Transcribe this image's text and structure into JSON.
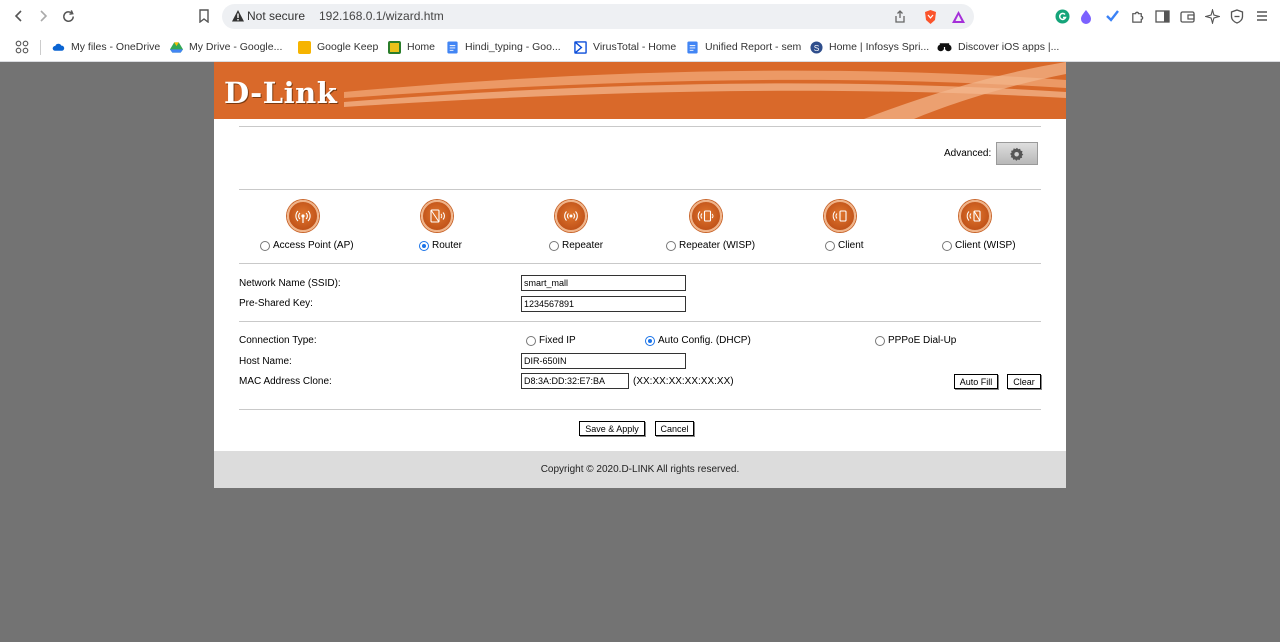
{
  "browser": {
    "security_label": "Not secure",
    "url": "192.168.0.1/wizard.htm",
    "bookmarks": [
      {
        "label": "My files - OneDrive"
      },
      {
        "label": "My Drive - Google..."
      },
      {
        "label": "Google Keep"
      },
      {
        "label": "Home"
      },
      {
        "label": "Hindi_typing - Goo..."
      },
      {
        "label": "VirusTotal - Home"
      },
      {
        "label": "Unified Report - sem"
      },
      {
        "label": "Home | Infosys Spri..."
      },
      {
        "label": "Discover iOS apps |..."
      }
    ]
  },
  "router": {
    "brand": "D-Link",
    "advanced_label": "Advanced:",
    "modes": [
      {
        "label": "Access Point (AP)",
        "selected": false
      },
      {
        "label": "Router",
        "selected": true
      },
      {
        "label": "Repeater",
        "selected": false
      },
      {
        "label": "Repeater (WISP)",
        "selected": false
      },
      {
        "label": "Client",
        "selected": false
      },
      {
        "label": "Client (WISP)",
        "selected": false
      }
    ],
    "ssid_label": "Network Name (SSID):",
    "ssid_value": "smart_mall",
    "psk_label": "Pre-Shared Key:",
    "psk_value": "1234567891",
    "connection_type_label": "Connection Type:",
    "connection_options": [
      {
        "label": "Fixed IP",
        "selected": false
      },
      {
        "label": "Auto Config. (DHCP)",
        "selected": true
      },
      {
        "label": "PPPoE Dial-Up",
        "selected": false
      }
    ],
    "host_label": "Host Name:",
    "host_value": "DIR-650IN",
    "mac_label": "MAC Address Clone:",
    "mac_value": "D8:3A:DD:32:E7:BA",
    "mac_hint": "(XX:XX:XX:XX:XX:XX)",
    "auto_fill_label": "Auto Fill",
    "clear_label": "Clear",
    "save_label": "Save & Apply",
    "cancel_label": "Cancel",
    "copyright": "Copyright © 2020.D-LINK All rights reserved."
  },
  "colors": {
    "banner": "#d9692a",
    "accent": "#1a73e8",
    "backdrop": "#737373"
  }
}
